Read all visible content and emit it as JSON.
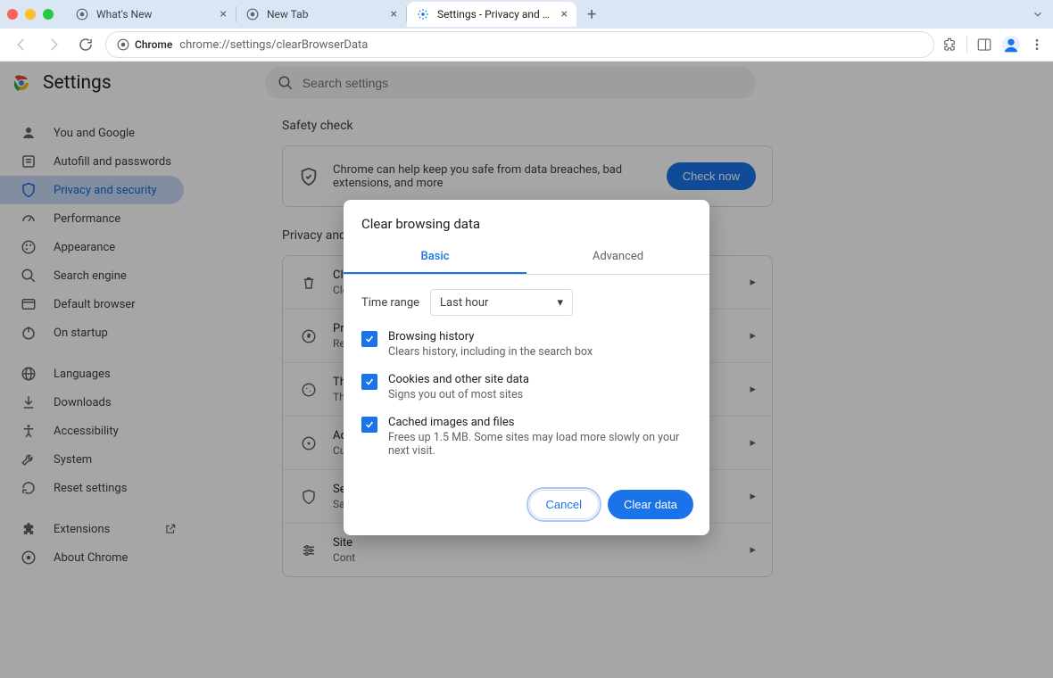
{
  "tabs": [
    {
      "title": "What's New"
    },
    {
      "title": "New Tab"
    },
    {
      "title": "Settings - Privacy and securi"
    }
  ],
  "omnibox": {
    "chip": "Chrome",
    "url": "chrome://settings/clearBrowserData"
  },
  "settings_title": "Settings",
  "search_placeholder": "Search settings",
  "sidebar": [
    {
      "label": "You and Google"
    },
    {
      "label": "Autofill and passwords"
    },
    {
      "label": "Privacy and security"
    },
    {
      "label": "Performance"
    },
    {
      "label": "Appearance"
    },
    {
      "label": "Search engine"
    },
    {
      "label": "Default browser"
    },
    {
      "label": "On startup"
    },
    {
      "label": "Languages"
    },
    {
      "label": "Downloads"
    },
    {
      "label": "Accessibility"
    },
    {
      "label": "System"
    },
    {
      "label": "Reset settings"
    },
    {
      "label": "Extensions"
    },
    {
      "label": "About Chrome"
    }
  ],
  "safety": {
    "heading": "Safety check",
    "text": "Chrome can help keep you safe from data breaches, bad extensions, and more",
    "button": "Check now"
  },
  "section2_heading": "Privacy and",
  "rows": [
    {
      "title": "Clea",
      "sub": "Clea"
    },
    {
      "title": "Priv",
      "sub": "Revi"
    },
    {
      "title": "Thir",
      "sub": "Thir"
    },
    {
      "title": "Ad p",
      "sub": "Cust"
    },
    {
      "title": "Secu",
      "sub": "Safe"
    },
    {
      "title": "Site",
      "sub": "Cont"
    }
  ],
  "dialog": {
    "title": "Clear browsing data",
    "tab_basic": "Basic",
    "tab_advanced": "Advanced",
    "time_label": "Time range",
    "time_value": "Last hour",
    "items": [
      {
        "title": "Browsing history",
        "sub": "Clears history, including in the search box"
      },
      {
        "title": "Cookies and other site data",
        "sub": "Signs you out of most sites"
      },
      {
        "title": "Cached images and files",
        "sub": "Frees up 1.5 MB. Some sites may load more slowly on your next visit."
      }
    ],
    "cancel": "Cancel",
    "confirm": "Clear data"
  }
}
